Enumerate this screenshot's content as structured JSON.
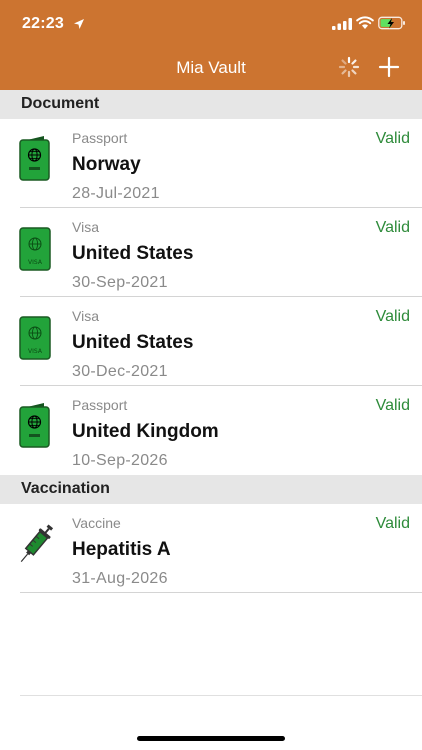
{
  "status_bar": {
    "time": "22:23"
  },
  "nav": {
    "title": "Mia Vault"
  },
  "sections": [
    {
      "title": "Document",
      "rows": [
        {
          "type": "Passport",
          "name": "Norway",
          "date": "28-Jul-2021",
          "status": "Valid",
          "icon": "passport-icon"
        },
        {
          "type": "Visa",
          "name": "United States",
          "date": "30-Sep-2021",
          "status": "Valid",
          "icon": "visa-icon"
        },
        {
          "type": "Visa",
          "name": "United States",
          "date": "30-Dec-2021",
          "status": "Valid",
          "icon": "visa-icon"
        },
        {
          "type": "Passport",
          "name": "United Kingdom",
          "date": "10-Sep-2026",
          "status": "Valid",
          "icon": "passport-icon"
        }
      ]
    },
    {
      "title": "Vaccination",
      "rows": [
        {
          "type": "Vaccine",
          "name": "Hepatitis A",
          "date": "31-Aug-2026",
          "status": "Valid",
          "icon": "syringe-icon"
        }
      ]
    }
  ],
  "colors": {
    "header": "#cc7430",
    "status_valid": "#2e8b3a",
    "section_bg": "#e6e6e6",
    "document_icon": "#22a33a"
  }
}
